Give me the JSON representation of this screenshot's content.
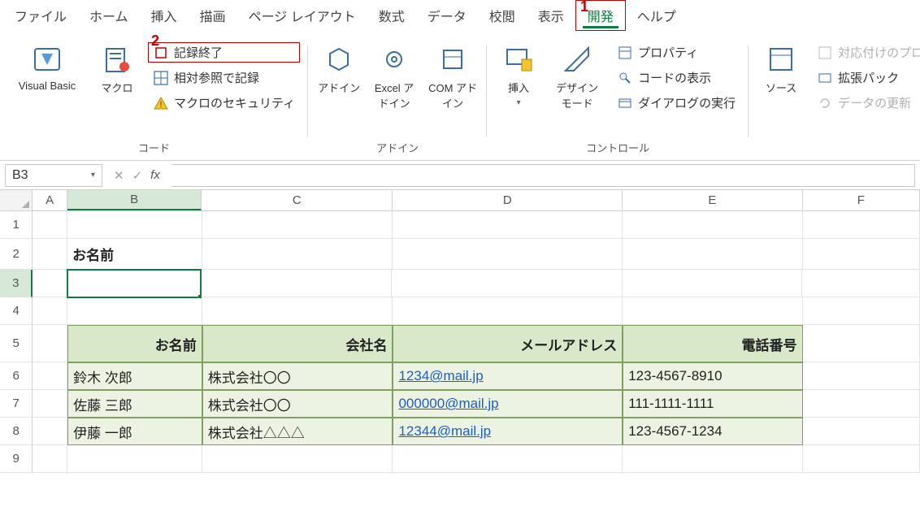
{
  "menu": {
    "items": [
      "ファイル",
      "ホーム",
      "挿入",
      "描画",
      "ページ レイアウト",
      "数式",
      "データ",
      "校閲",
      "表示",
      "開発",
      "ヘルプ"
    ],
    "activeIndex": 9
  },
  "annotations": {
    "num1": "1",
    "num2": "2"
  },
  "ribbon": {
    "groups": {
      "code": {
        "label": "コード",
        "visualBasic": "Visual Basic",
        "macro": "マクロ",
        "stopRecording": "記録終了",
        "relativeRef": "相対参照で記録",
        "macroSecurity": "マクロのセキュリティ"
      },
      "addins": {
        "label": "アドイン",
        "addin": "アドイン",
        "excelAddin": "Excel アドイン",
        "comAddin": "COM アドイン"
      },
      "controls": {
        "label": "コントロール",
        "insert": "挿入",
        "designMode": "デザイン モード",
        "properties": "プロパティ",
        "viewCode": "コードの表示",
        "runDialog": "ダイアログの実行"
      },
      "xml": {
        "source": "ソース",
        "mapProps": "対応付けのプロパティ",
        "expansion": "拡張パック",
        "refresh": "データの更新"
      }
    }
  },
  "formulaBar": {
    "nameBox": "B3",
    "formula": ""
  },
  "grid": {
    "columns": [
      "A",
      "B",
      "C",
      "D",
      "E",
      "F"
    ],
    "selectedCell": "B3",
    "label_B2": "お名前",
    "headers": {
      "name": "お名前",
      "company": "会社名",
      "email": "メールアドレス",
      "phone": "電話番号"
    },
    "rows": [
      {
        "name": "鈴木 次郎",
        "company": "株式会社〇〇",
        "email": "1234@mail.jp",
        "phone": "123-4567-8910"
      },
      {
        "name": "佐藤 三郎",
        "company": "株式会社〇〇",
        "email": "000000@mail.jp",
        "phone": "111-1111-1111"
      },
      {
        "name": "伊藤 一郎",
        "company": "株式会社△△△",
        "email": "12344@mail.jp",
        "phone": "123-4567-1234"
      }
    ]
  }
}
